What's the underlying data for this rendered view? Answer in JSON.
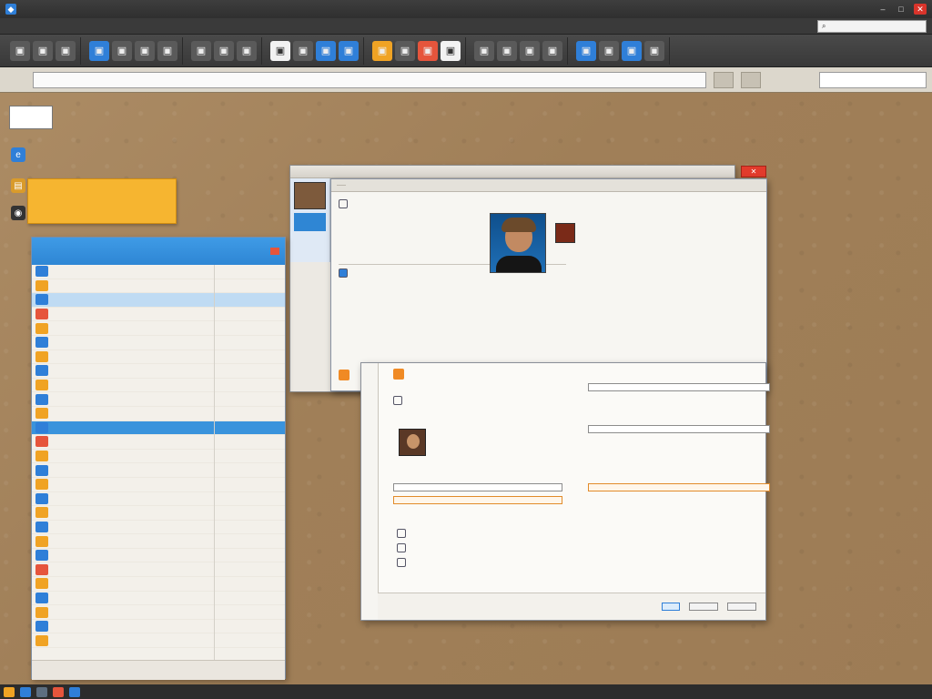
{
  "app": {
    "title": "",
    "menu": [
      "",
      "",
      "",
      "",
      "",
      ""
    ],
    "toolbar_search": ""
  },
  "ribbon": {
    "groups": [
      {
        "buttons": [
          {
            "icon": "doc-icon"
          },
          {
            "icon": "doc-icon"
          },
          {
            "icon": "doc-icon"
          }
        ]
      },
      {
        "buttons": [
          {
            "icon": "doc-icon",
            "tone": "blue"
          },
          {
            "icon": "doc-icon"
          },
          {
            "icon": "doc-icon"
          },
          {
            "icon": "doc-icon"
          }
        ]
      },
      {
        "buttons": [
          {
            "icon": "doc-icon"
          },
          {
            "icon": "doc-icon"
          },
          {
            "icon": "doc-icon"
          }
        ]
      },
      {
        "buttons": [
          {
            "icon": "doc-icon",
            "tone": "white"
          },
          {
            "icon": "doc-icon"
          },
          {
            "icon": "doc-icon",
            "tone": "blue"
          },
          {
            "icon": "doc-icon",
            "tone": "blue"
          }
        ]
      },
      {
        "buttons": [
          {
            "icon": "doc-icon",
            "tone": "orange"
          },
          {
            "icon": "doc-icon"
          },
          {
            "icon": "doc-icon",
            "tone": "red"
          },
          {
            "icon": "doc-icon",
            "tone": "white"
          }
        ]
      },
      {
        "buttons": [
          {
            "icon": "doc-icon"
          },
          {
            "icon": "doc-icon"
          },
          {
            "icon": "doc-icon"
          },
          {
            "icon": "doc-icon"
          }
        ]
      },
      {
        "buttons": [
          {
            "icon": "doc-icon",
            "tone": "blue"
          },
          {
            "icon": "doc-icon"
          },
          {
            "icon": "doc-icon",
            "tone": "blue"
          },
          {
            "icon": "doc-icon"
          }
        ]
      }
    ]
  },
  "address": {
    "value": "",
    "search_placeholder": ""
  },
  "desktop": {
    "note_label": "",
    "note_caption": "",
    "side_label": "",
    "sticky_title": "",
    "sticky_lines": [
      "",
      "",
      ""
    ]
  },
  "list_window": {
    "title": "",
    "rows": [
      {
        "label": "",
        "color": "#2f7fd8",
        "state": ""
      },
      {
        "label": "",
        "color": "#f0a324",
        "state": ""
      },
      {
        "label": "",
        "color": "#2f7fd8",
        "state": "sel"
      },
      {
        "label": "",
        "color": "#e6553c",
        "state": ""
      },
      {
        "label": "",
        "color": "#f0a324",
        "state": ""
      },
      {
        "label": "",
        "color": "#2f7fd8",
        "state": ""
      },
      {
        "label": "",
        "color": "#f0a324",
        "state": ""
      },
      {
        "label": "",
        "color": "#2f7fd8",
        "state": ""
      },
      {
        "label": "",
        "color": "#f0a324",
        "state": ""
      },
      {
        "label": "",
        "color": "#2f7fd8",
        "state": ""
      },
      {
        "label": "",
        "color": "#f0a324",
        "state": ""
      },
      {
        "label": "",
        "color": "#2f7fd8",
        "state": "sel2"
      },
      {
        "label": "",
        "color": "#e6553c",
        "state": ""
      },
      {
        "label": "",
        "color": "#f0a324",
        "state": ""
      },
      {
        "label": "",
        "color": "#2f7fd8",
        "state": ""
      },
      {
        "label": "",
        "color": "#f0a324",
        "state": ""
      },
      {
        "label": "",
        "color": "#2f7fd8",
        "state": ""
      },
      {
        "label": "",
        "color": "#f0a324",
        "state": ""
      },
      {
        "label": "",
        "color": "#2f7fd8",
        "state": ""
      },
      {
        "label": "",
        "color": "#f0a324",
        "state": ""
      },
      {
        "label": "",
        "color": "#2f7fd8",
        "state": ""
      },
      {
        "label": "",
        "color": "#e6553c",
        "state": ""
      },
      {
        "label": "",
        "color": "#f0a324",
        "state": ""
      },
      {
        "label": "",
        "color": "#2f7fd8",
        "state": ""
      },
      {
        "label": "",
        "color": "#f0a324",
        "state": ""
      },
      {
        "label": "",
        "color": "#2f7fd8",
        "state": ""
      },
      {
        "label": "",
        "color": "#f0a324",
        "state": ""
      }
    ],
    "footer_left": "",
    "footer_right": ""
  },
  "back_dialog": {
    "title": "",
    "tabs": [
      "",
      "",
      "",
      ""
    ]
  },
  "main_dialog": {
    "tabs": [
      "",
      "",
      "",
      "",
      ""
    ],
    "left_lines": [
      "",
      "",
      "",
      "",
      "",
      ""
    ],
    "right_lines": [
      "",
      "",
      "",
      "",
      "",
      ""
    ],
    "footer": [
      "",
      ""
    ]
  },
  "lower_panel": {
    "header": "",
    "lines": [
      "",
      "",
      "",
      "",
      "",
      ""
    ],
    "right_lines": [
      "",
      "",
      "",
      "",
      "",
      ""
    ],
    "footer": [
      "",
      "",
      ""
    ]
  },
  "statusbar": {
    "items": [
      "",
      "",
      "",
      "",
      ""
    ]
  }
}
